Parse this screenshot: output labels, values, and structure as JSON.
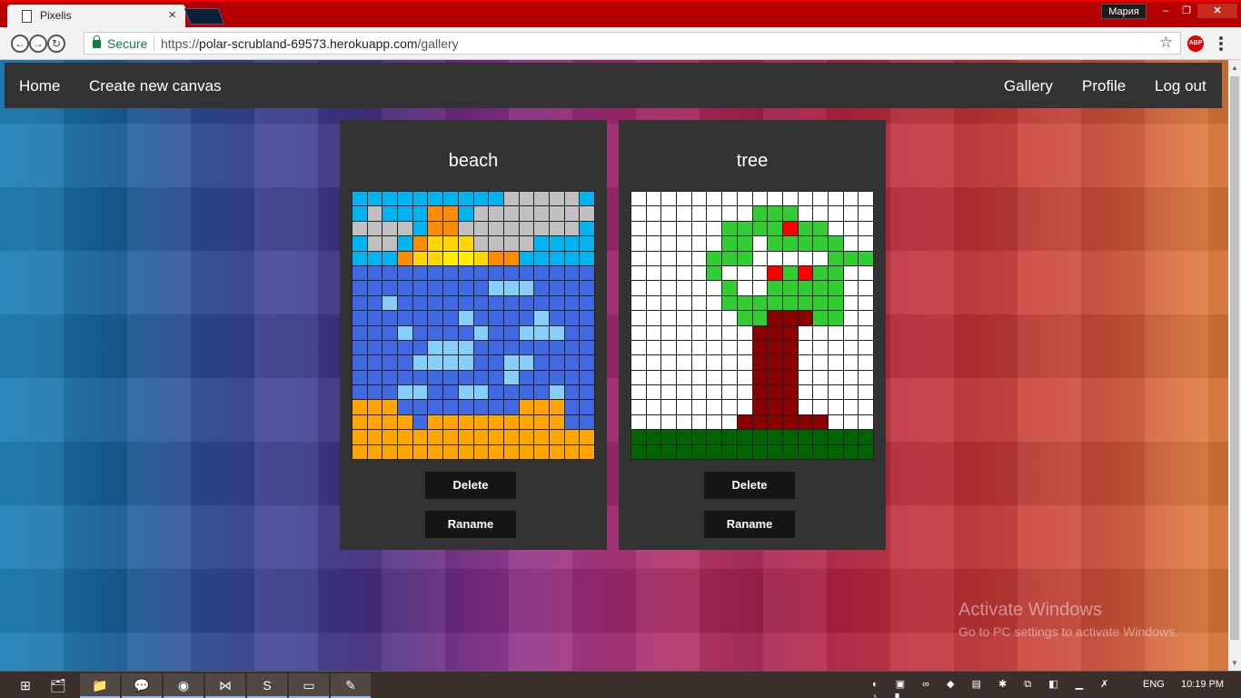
{
  "browser": {
    "tab_title": "Pixelis",
    "tab_close": "×",
    "user_badge": "Мария",
    "window_min": "‒",
    "window_max": "❐",
    "window_close": "✕",
    "secure_label": "Secure",
    "url_scheme": "https://",
    "url_host": "polar-scrubland-69573.herokuapp.com",
    "url_path": "/gallery",
    "star": "☆",
    "abp": "ABP"
  },
  "navbar": {
    "home": "Home",
    "create": "Create new canvas",
    "gallery": "Gallery",
    "profile": "Profile",
    "logout": "Log out"
  },
  "canvases": [
    {
      "title": "beach",
      "delete_label": "Delete",
      "rename_label": "Raname",
      "palette": {
        "S": "#00b4f0",
        "G": "#c0c0c0",
        "O": "#ff8c00",
        "Y": "#ffd700",
        "W": "#ffee00",
        "A": "#ffa500",
        "B": "#4169e1",
        "L": "#87cefa"
      },
      "rows": [
        "SSSSSSSSSSGGGGGS",
        "SGSSSOOSGGGGGGGG",
        "GGGGSOOGGGGGGGGS",
        "SGGSOYYYGGGGSSSS",
        "SSSOYYWWYOOSSSSS",
        "BBBBBBBBBBBBBBBB",
        "BBBBBBBBBLLLBBBB",
        "BBLBBBBBBBBBBBBB",
        "BBBBBBBLBBBBLBBB",
        "BBBLBBBBLBBLLLBB",
        "BBBBBLLLBBBBBBBB",
        "BBBBLLLLBBLLBBBB",
        "BBBBBBBBBBLBBBBB",
        "BBBLLBBLLBBBBLBB",
        "AAABBBBBBBBAAABB",
        "AAAABAAAAAAAAABB",
        "AAAAAAAAAAAAAAAA",
        "AAAAAAAAAAAAAAAA"
      ]
    },
    {
      "title": "tree",
      "delete_label": "Delete",
      "rename_label": "Raname",
      "palette": {
        ".": "#ffffff",
        "G": "#32cd32",
        "R": "#ff0000",
        "T": "#8b0000",
        "D": "#006400"
      },
      "rows": [
        "................",
        "........GGG.....",
        "......GGGGRGG...",
        "......GG.GGGGG..",
        ".....GGG.....GGG",
        ".....G...RGRGG..",
        "......G..GGGGG..",
        "......GGGGGGGG..",
        ".......GGTTTGG..",
        "........TTT.....",
        "........TTT.....",
        "........TTT.....",
        "........TTT.....",
        "........TTT.....",
        "........TTT.....",
        ".......TTTTTT...",
        "DDDDDDDDDDDDDDDD",
        "DDDDDDDDDDDDDDDD"
      ]
    }
  ],
  "watermark": {
    "line1": "Activate Windows",
    "line2": "Go to PC settings to activate Windows."
  },
  "taskbar": {
    "start": "⊞",
    "apps": [
      "🗂",
      "📁",
      "💬",
      "◉",
      "⋈",
      "S",
      "▭",
      "✎"
    ],
    "tray": "◐ ▣ ∞ ◆ ▤ ✱ ⧉ ◧ ▁ ✗ ♪ ▮",
    "language": "ENG",
    "clock": "10:19 PM"
  }
}
